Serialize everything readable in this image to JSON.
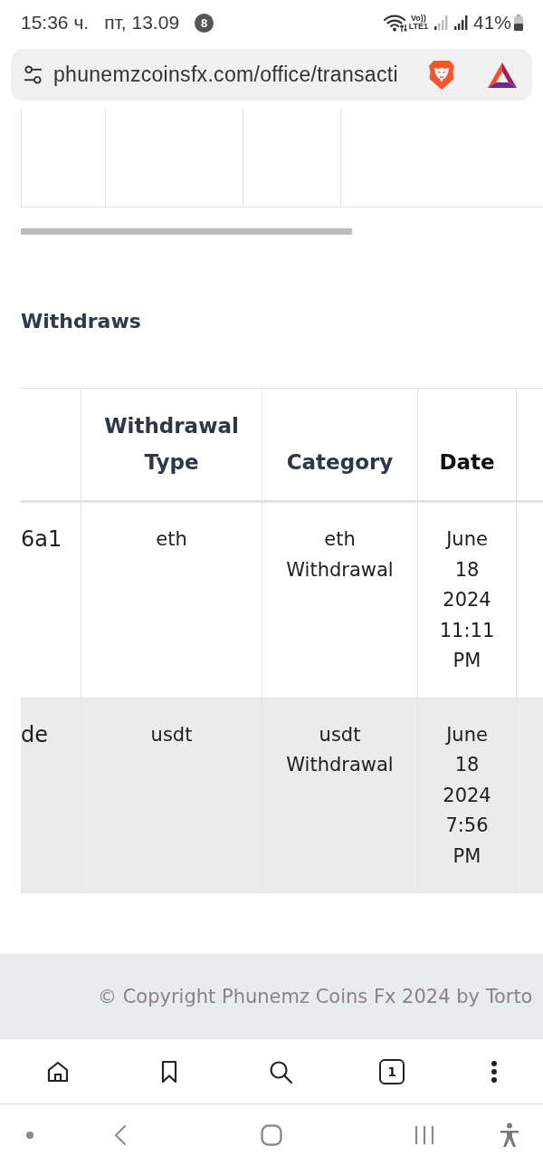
{
  "status_bar": {
    "time": "15:36 ч.",
    "date": "пт, 13.09",
    "notification_count": "8",
    "network_type": [
      "Vo))",
      "LTE1"
    ],
    "battery": "41%"
  },
  "address_bar": {
    "url": "phunemzcoinsfx.com/office/transacti"
  },
  "withdraws": {
    "title": "Withdraws",
    "table": {
      "columns": [
        {},
        {
          "label": "Withdrawal Type",
          "color": "#2d3748"
        },
        {
          "label": "Category",
          "color": "#2d3748"
        },
        {
          "label": "Date",
          "color": "#111111"
        }
      ],
      "rows": [
        {
          "cells": [
            "6a1",
            "eth",
            "eth Withdrawal",
            "June 18 2024 11:11 PM"
          ],
          "highlighted": false
        },
        {
          "cells": [
            "de",
            "usdt",
            "usdt Withdrawal",
            "June 18 2024 7:56 PM"
          ],
          "highlighted": true
        }
      ]
    }
  },
  "footer": {
    "text": "© Copyright Phunemz Coins Fx 2024 by Torto"
  },
  "browser_toolbar": {
    "tab_count": "1"
  }
}
